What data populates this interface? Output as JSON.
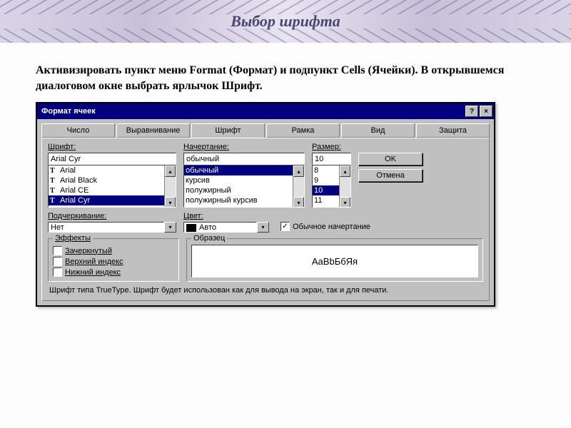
{
  "banner": {
    "title": "Выбор шрифта"
  },
  "instructions": "Активизировать пункт меню Format (Формат) и подпункт Cells (Ячейки). В открывшемся диалоговом окне выбрать ярлычок Шрифт.",
  "dialog": {
    "title": "Формат ячеек",
    "help": "?",
    "close": "×",
    "tabs": [
      "Число",
      "Выравнивание",
      "Шрифт",
      "Рамка",
      "Вид",
      "Защита"
    ],
    "activeTab": 2,
    "font": {
      "label": "Шрифт:",
      "value": "Arial Cyr",
      "list": [
        "Arial",
        "Arial Black",
        "Arial CE",
        "Arial Cyr"
      ]
    },
    "style": {
      "label": "Начертание:",
      "value": "обычный",
      "list": [
        "обычный",
        "курсив",
        "полужирный",
        "полужирный курсив"
      ]
    },
    "size": {
      "label": "Размер:",
      "value": "10",
      "list": [
        "8",
        "9",
        "10",
        "11"
      ]
    },
    "buttons": {
      "ok": "OK",
      "cancel": "Отмена"
    },
    "underline": {
      "label": "Подчеркивание:",
      "value": "Нет"
    },
    "color": {
      "label": "Цвет:",
      "value": "Авто"
    },
    "normalFont": {
      "label": "Обычное начертание",
      "checked": true
    },
    "effects": {
      "title": "Эффекты",
      "strike": "Зачеркнутый",
      "super": "Верхний индекс",
      "sub": "Нижний индекс"
    },
    "preview": {
      "title": "Образец",
      "text": "AaBbБбЯя"
    },
    "info": "Шрифт типа TrueType. Шрифт будет использован как для вывода на экран, так и для печати."
  }
}
